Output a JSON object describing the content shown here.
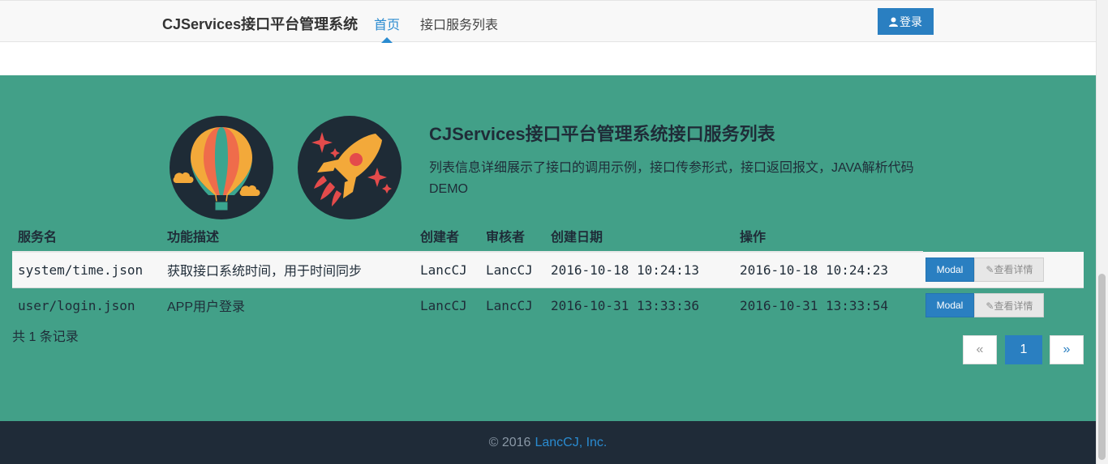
{
  "navbar": {
    "brand": "CJServices接口平台管理系统",
    "links": [
      {
        "label": "首页"
      },
      {
        "label": "接口服务列表"
      }
    ],
    "login_label": "登录"
  },
  "hero": {
    "title": "CJServices接口平台管理系统接口服务列表",
    "description": "列表信息详细展示了接口的调用示例，接口传参形式，接口返回报文，JAVA解析代码DEMO",
    "icons": [
      "hot-air-balloon-icon",
      "rocket-icon"
    ]
  },
  "table": {
    "headers": [
      "服务名",
      "功能描述",
      "创建者",
      "审核者",
      "创建日期",
      "操作"
    ],
    "rows": [
      {
        "service": "system/time.json",
        "desc": "获取接口系统时间，用于时间同步",
        "creator": "LancCJ",
        "reviewer": "LancCJ",
        "created": "2016-10-18 10:24:13",
        "op_time": "2016-10-18 10:24:23",
        "modal": "Modal",
        "detail": "查看详情"
      },
      {
        "service": "user/login.json",
        "desc": "APP用户登录",
        "creator": "LancCJ",
        "reviewer": "LancCJ",
        "created": "2016-10-31 13:33:36",
        "op_time": "2016-10-31 13:33:54",
        "modal": "Modal",
        "detail": "查看详情"
      }
    ]
  },
  "record_count": "共 1 条记录",
  "pagination": {
    "prev": "«",
    "current": "1",
    "next": "»"
  },
  "footer": {
    "copyright": "© 2016",
    "company": "LancCJ, Inc."
  },
  "colors": {
    "hero_bg": "#42a088",
    "accent": "#2a7fc1",
    "footer_bg": "#1f2b38"
  }
}
